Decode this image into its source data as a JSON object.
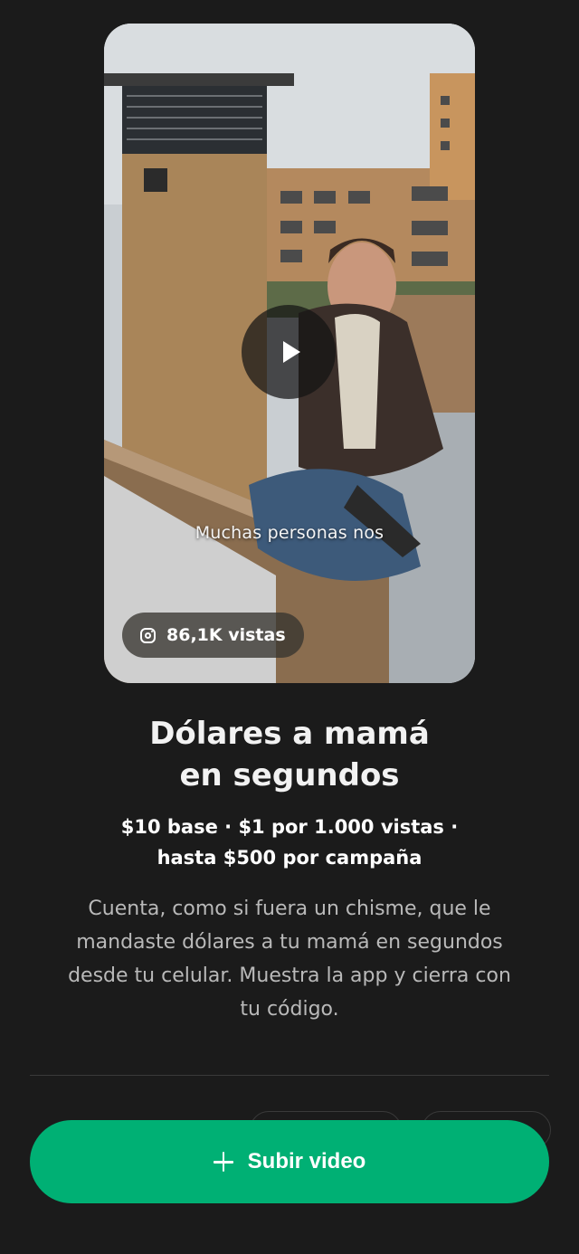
{
  "video": {
    "caption": "Muchas personas nos",
    "views": "86,1K vistas",
    "platform_icon": "instagram-icon"
  },
  "campaign": {
    "title_lines": [
      "Dólares a mamá",
      "en segundos"
    ],
    "pricing_lines": [
      "$10 base · $1 por 1.000 vistas ·",
      "hasta $500 por campaña"
    ],
    "description_lines": [
      "Cuenta, como si fuera un chisme, que le",
      "mandaste dólares a tu mamá en segundos",
      "desde tu celular. Muestra la app y cierra con",
      "tu código."
    ]
  },
  "actions": {
    "upload_label": "Subir video",
    "upload_icon": "plus-icon"
  },
  "colors": {
    "background": "#1b1b1b",
    "accent": "#00b074",
    "muted_text": "#b9b9b9"
  }
}
